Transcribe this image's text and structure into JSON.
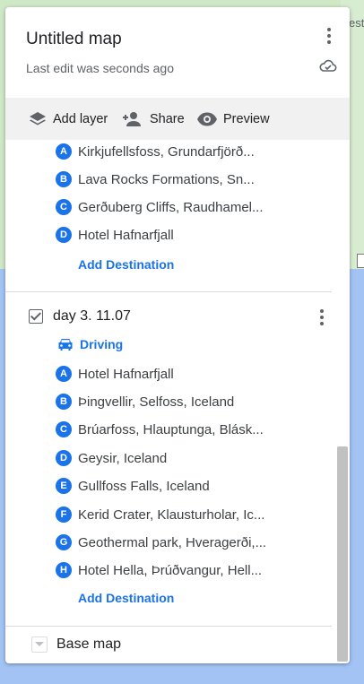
{
  "header": {
    "title": "Untitled map",
    "last_edit": "Last edit was seconds ago"
  },
  "toolbar": {
    "add_layer": "Add layer",
    "share": "Share",
    "preview": "Preview"
  },
  "layer_prev": {
    "stops": [
      {
        "letter": "A",
        "label": "Kirkjufellsfoss, Grundarfjörð..."
      },
      {
        "letter": "B",
        "label": "Lava Rocks Formations, Sn..."
      },
      {
        "letter": "C",
        "label": "Gerðuberg Cliffs, Raudhamel..."
      },
      {
        "letter": "D",
        "label": "Hotel Hafnarfjall"
      }
    ],
    "add_destination": "Add Destination"
  },
  "layer_day3": {
    "name": "day 3. 11.07",
    "checked": true,
    "mode": "Driving",
    "stops": [
      {
        "letter": "A",
        "label": "Hotel Hafnarfjall"
      },
      {
        "letter": "B",
        "label": "Þingvellir, Selfoss, Iceland"
      },
      {
        "letter": "C",
        "label": "Brúarfoss, Hlauptunga, Blásk..."
      },
      {
        "letter": "D",
        "label": "Geysir, Iceland"
      },
      {
        "letter": "E",
        "label": "Gullfoss Falls, Iceland"
      },
      {
        "letter": "F",
        "label": "Kerid Crater, Klausturholar, Ic..."
      },
      {
        "letter": "G",
        "label": "Geothermal park, Hveragerði,..."
      },
      {
        "letter": "H",
        "label": "Hotel Hella, Þrúðvangur, Hell..."
      }
    ],
    "add_destination": "Add Destination"
  },
  "base_map": {
    "label": "Base map"
  },
  "map_overlay": {
    "edge_text": "est"
  },
  "colors": {
    "accent": "#1a73e8",
    "toolbar_bg": "#f1f1f1",
    "water": "#a3c3f5",
    "land": "#cfe9c6"
  }
}
